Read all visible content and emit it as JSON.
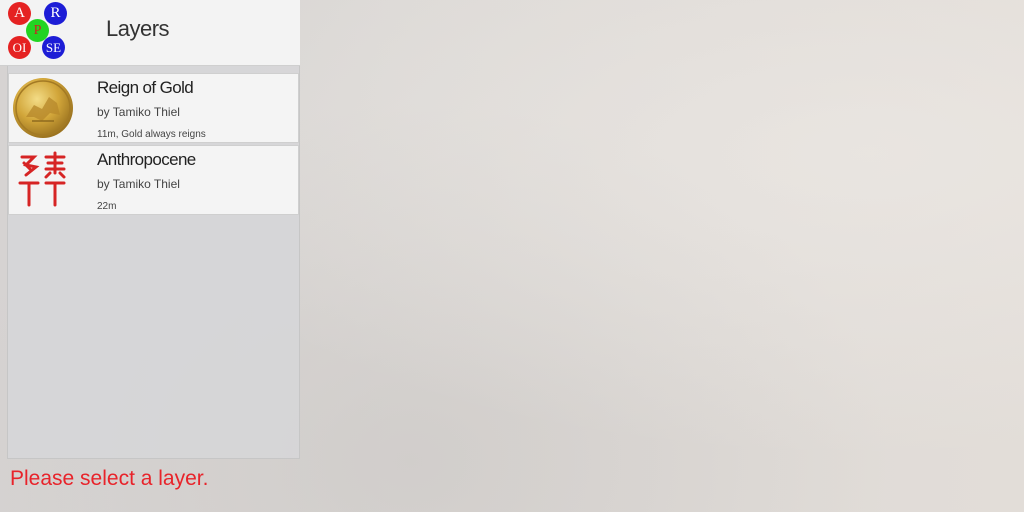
{
  "header": {
    "title": "Layers",
    "logo": {
      "letters": [
        "A",
        "R",
        "P",
        "OI",
        "SE"
      ],
      "colors": [
        "#e52222",
        "#1d1dd6",
        "#22d422",
        "#e52222",
        "#1d1dd6"
      ]
    }
  },
  "layers": [
    {
      "title": "Reign of Gold",
      "author": "by Tamiko Thiel",
      "desc": "11m, Gold always reigns",
      "icon": "gold-coin-icon"
    },
    {
      "title": "Anthropocene",
      "author": "by Tamiko Thiel",
      "desc": "22m",
      "icon": "red-seal-icon"
    }
  ],
  "status": {
    "text": "Please select a layer.",
    "color": "#e8232a"
  }
}
